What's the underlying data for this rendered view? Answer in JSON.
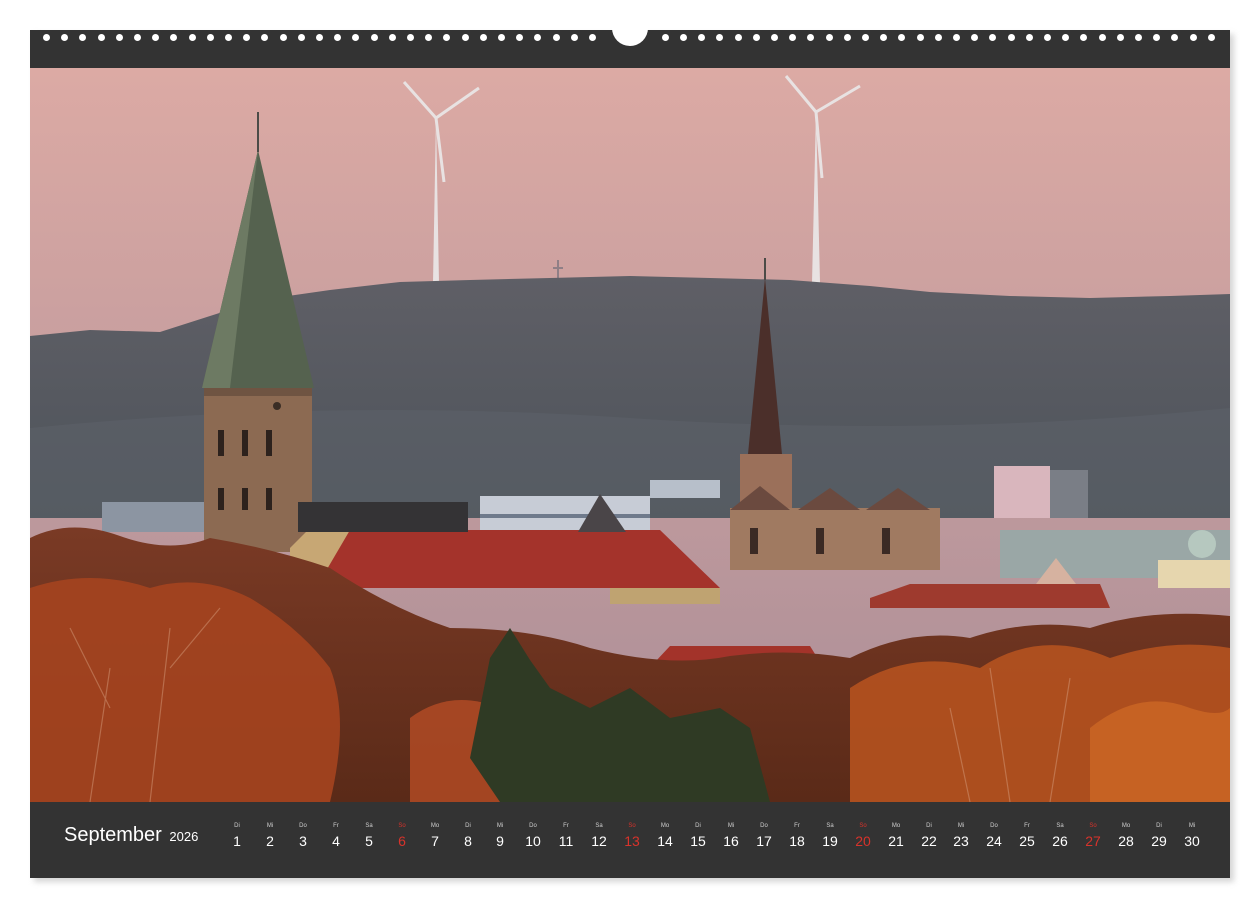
{
  "calendar": {
    "month": "September",
    "year": "2026",
    "days": [
      {
        "dow": "Di",
        "num": "1",
        "sunday": false
      },
      {
        "dow": "Mi",
        "num": "2",
        "sunday": false
      },
      {
        "dow": "Do",
        "num": "3",
        "sunday": false
      },
      {
        "dow": "Fr",
        "num": "4",
        "sunday": false
      },
      {
        "dow": "Sa",
        "num": "5",
        "sunday": false
      },
      {
        "dow": "So",
        "num": "6",
        "sunday": true
      },
      {
        "dow": "Mo",
        "num": "7",
        "sunday": false
      },
      {
        "dow": "Di",
        "num": "8",
        "sunday": false
      },
      {
        "dow": "Mi",
        "num": "9",
        "sunday": false
      },
      {
        "dow": "Do",
        "num": "10",
        "sunday": false
      },
      {
        "dow": "Fr",
        "num": "11",
        "sunday": false
      },
      {
        "dow": "Sa",
        "num": "12",
        "sunday": false
      },
      {
        "dow": "So",
        "num": "13",
        "sunday": true
      },
      {
        "dow": "Mo",
        "num": "14",
        "sunday": false
      },
      {
        "dow": "Di",
        "num": "15",
        "sunday": false
      },
      {
        "dow": "Mi",
        "num": "16",
        "sunday": false
      },
      {
        "dow": "Do",
        "num": "17",
        "sunday": false
      },
      {
        "dow": "Fr",
        "num": "18",
        "sunday": false
      },
      {
        "dow": "Sa",
        "num": "19",
        "sunday": false
      },
      {
        "dow": "So",
        "num": "20",
        "sunday": true
      },
      {
        "dow": "Mo",
        "num": "21",
        "sunday": false
      },
      {
        "dow": "Di",
        "num": "22",
        "sunday": false
      },
      {
        "dow": "Mi",
        "num": "23",
        "sunday": false
      },
      {
        "dow": "Do",
        "num": "24",
        "sunday": false
      },
      {
        "dow": "Fr",
        "num": "25",
        "sunday": false
      },
      {
        "dow": "Sa",
        "num": "26",
        "sunday": false
      },
      {
        "dow": "So",
        "num": "27",
        "sunday": true
      },
      {
        "dow": "Mo",
        "num": "28",
        "sunday": false
      },
      {
        "dow": "Di",
        "num": "29",
        "sunday": false
      },
      {
        "dow": "Mi",
        "num": "30",
        "sunday": false
      }
    ]
  },
  "colors": {
    "frame": "#333333",
    "sunday": "#d8332b",
    "sky_top": "#d9a9a4",
    "sky_bottom": "#ad8e98",
    "hills": "#545860",
    "roof": "#a4332b",
    "foliage": "#a44321"
  }
}
